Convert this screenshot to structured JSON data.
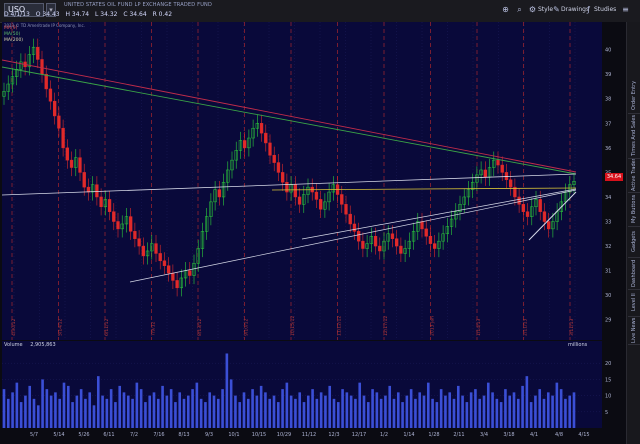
{
  "toolbar": {
    "symbol": "USO",
    "symbol_dropdown": "▾",
    "description": "UNITED STATES OIL FUND LP EXCHANGE TRADED FUND",
    "quote": [
      "D 4/1/13",
      "O 34.43",
      "H 34.74",
      "L 34.32",
      "C 34.64",
      "R 0.42"
    ],
    "style_label": "Style",
    "drawings_label": "Drawings",
    "studies_label": "Studies"
  },
  "chart": {
    "copyright": "2013 © TD Ameritrade IP Company, Inc.",
    "legend": [
      "MA(9)",
      "MA(50)",
      "MA(200)"
    ],
    "last_price": "34.64",
    "price_ticks": [
      "40",
      "39",
      "38",
      "37",
      "36",
      "35",
      "34",
      "33",
      "32",
      "31",
      "30",
      "29"
    ],
    "volume_label": "Volume",
    "volume_value": "2,905,863",
    "volume_units": "millions",
    "volume_ticks": [
      "20",
      "15",
      "10",
      "5"
    ],
    "time_ticks": [
      "5/7",
      "5/14",
      "5/26",
      "6/11",
      "7/2",
      "7/16",
      "8/13",
      "9/3",
      "10/1",
      "10/15",
      "10/29",
      "11/12",
      "12/3",
      "12/17",
      "1/2",
      "1/14",
      "1/28",
      "2/11",
      "3/4",
      "3/18",
      "4/1",
      "4/8",
      "4/15"
    ],
    "event_labels": [
      "4/30/12",
      "5/14/12",
      "6/11/12",
      "7/9/12",
      "8/13/12",
      "9/10/12",
      "10/15/12",
      "11/12/12",
      "12/17/12",
      "2013 Jan",
      "1/14/13",
      "2/11/13",
      "3/11/13"
    ]
  },
  "side_tabs": [
    "Live News",
    "Level II",
    "Dashboard",
    "Gadgets",
    "My Buttons",
    "Active Trader",
    "Times And Sales",
    "Order Entry"
  ],
  "colors": {
    "background": "#09093a",
    "up_candle": "#2ccf3c",
    "down_candle": "#e02a2a",
    "volume_bar": "#3b4fd6",
    "event_line": "#c22c2c",
    "trend_red": "#c02c4a",
    "trend_green": "#3aa447",
    "trend_white": "#d6d9e8",
    "trend_yellow": "#d8c338"
  },
  "chart_data": {
    "type": "candlestick",
    "title": "",
    "ylim": [
      28.5,
      40.8
    ],
    "closes": [
      38.3,
      38.6,
      38.9,
      39.2,
      39.5,
      39.3,
      39.8,
      40.1,
      39.6,
      39.0,
      38.4,
      37.9,
      37.3,
      36.8,
      36.0,
      35.5,
      35.2,
      35.6,
      35.0,
      34.4,
      34.2,
      34.5,
      34.0,
      33.6,
      33.9,
      33.4,
      33.0,
      32.7,
      32.9,
      33.2,
      32.6,
      32.3,
      32.0,
      31.6,
      31.8,
      32.1,
      31.7,
      31.4,
      31.2,
      30.9,
      30.6,
      30.3,
      30.7,
      31.0,
      30.8,
      31.3,
      31.9,
      32.6,
      33.2,
      33.8,
      34.3,
      34.0,
      34.6,
      35.1,
      35.5,
      35.9,
      36.3,
      36.0,
      36.4,
      36.8,
      37.0,
      36.6,
      36.2,
      35.7,
      35.4,
      35.0,
      34.6,
      34.2,
      34.5,
      34.0,
      33.7,
      34.1,
      34.4,
      34.2,
      33.9,
      33.5,
      33.8,
      34.2,
      34.5,
      34.1,
      33.7,
      33.3,
      32.9,
      32.6,
      32.2,
      31.9,
      32.1,
      32.4,
      32.0,
      31.8,
      32.2,
      32.5,
      32.3,
      32.0,
      31.7,
      31.9,
      32.2,
      32.6,
      33.0,
      32.7,
      32.4,
      32.1,
      31.9,
      32.2,
      32.5,
      32.8,
      33.1,
      33.4,
      33.7,
      34.0,
      34.3,
      34.6,
      34.9,
      35.1,
      34.8,
      35.2,
      35.5,
      35.3,
      35.0,
      34.7,
      34.4,
      34.0,
      33.7,
      33.4,
      33.2,
      33.6,
      33.9,
      33.4,
      33.0,
      32.7,
      33.0,
      33.4,
      33.8,
      34.2,
      34.5,
      34.64
    ],
    "volume": [
      12,
      9,
      11,
      14,
      8,
      10,
      13,
      9,
      7,
      15,
      12,
      10,
      11,
      9,
      14,
      13,
      8,
      10,
      12,
      9,
      11,
      7,
      16,
      10,
      9,
      12,
      8,
      13,
      11,
      10,
      9,
      14,
      12,
      8,
      10,
      11,
      9,
      13,
      10,
      12,
      8,
      11,
      9,
      10,
      12,
      14,
      9,
      8,
      11,
      10,
      9,
      12,
      23,
      15,
      10,
      8,
      11,
      9,
      12,
      10,
      13,
      11,
      9,
      10,
      8,
      12,
      14,
      10,
      9,
      11,
      8,
      10,
      12,
      9,
      11,
      10,
      13,
      9,
      8,
      12,
      11,
      10,
      9,
      14,
      10,
      8,
      12,
      11,
      9,
      10,
      13,
      9,
      11,
      8,
      10,
      12,
      9,
      11,
      10,
      14,
      9,
      8,
      12,
      10,
      11,
      9,
      13,
      10,
      8,
      11,
      12,
      9,
      10,
      14,
      11,
      9,
      8,
      12,
      10,
      11,
      9,
      13,
      16,
      8,
      10,
      12,
      9,
      11,
      10,
      14,
      12,
      9,
      10,
      11
    ]
  }
}
